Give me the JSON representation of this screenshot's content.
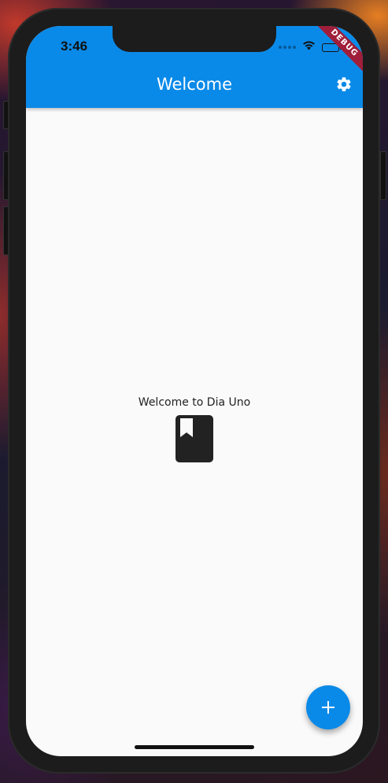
{
  "status_bar": {
    "time": "3:46",
    "icons": [
      "signal-dots-icon",
      "wifi-icon",
      "battery-icon"
    ]
  },
  "debug_banner": "DEBUG",
  "app_bar": {
    "title": "Welcome",
    "action_icon": "gear-icon",
    "color": "#0a8ae8"
  },
  "body": {
    "welcome_text": "Welcome to Dia Uno",
    "icon": "book-icon"
  },
  "fab": {
    "icon": "plus-icon",
    "color": "#0a8ae8"
  }
}
